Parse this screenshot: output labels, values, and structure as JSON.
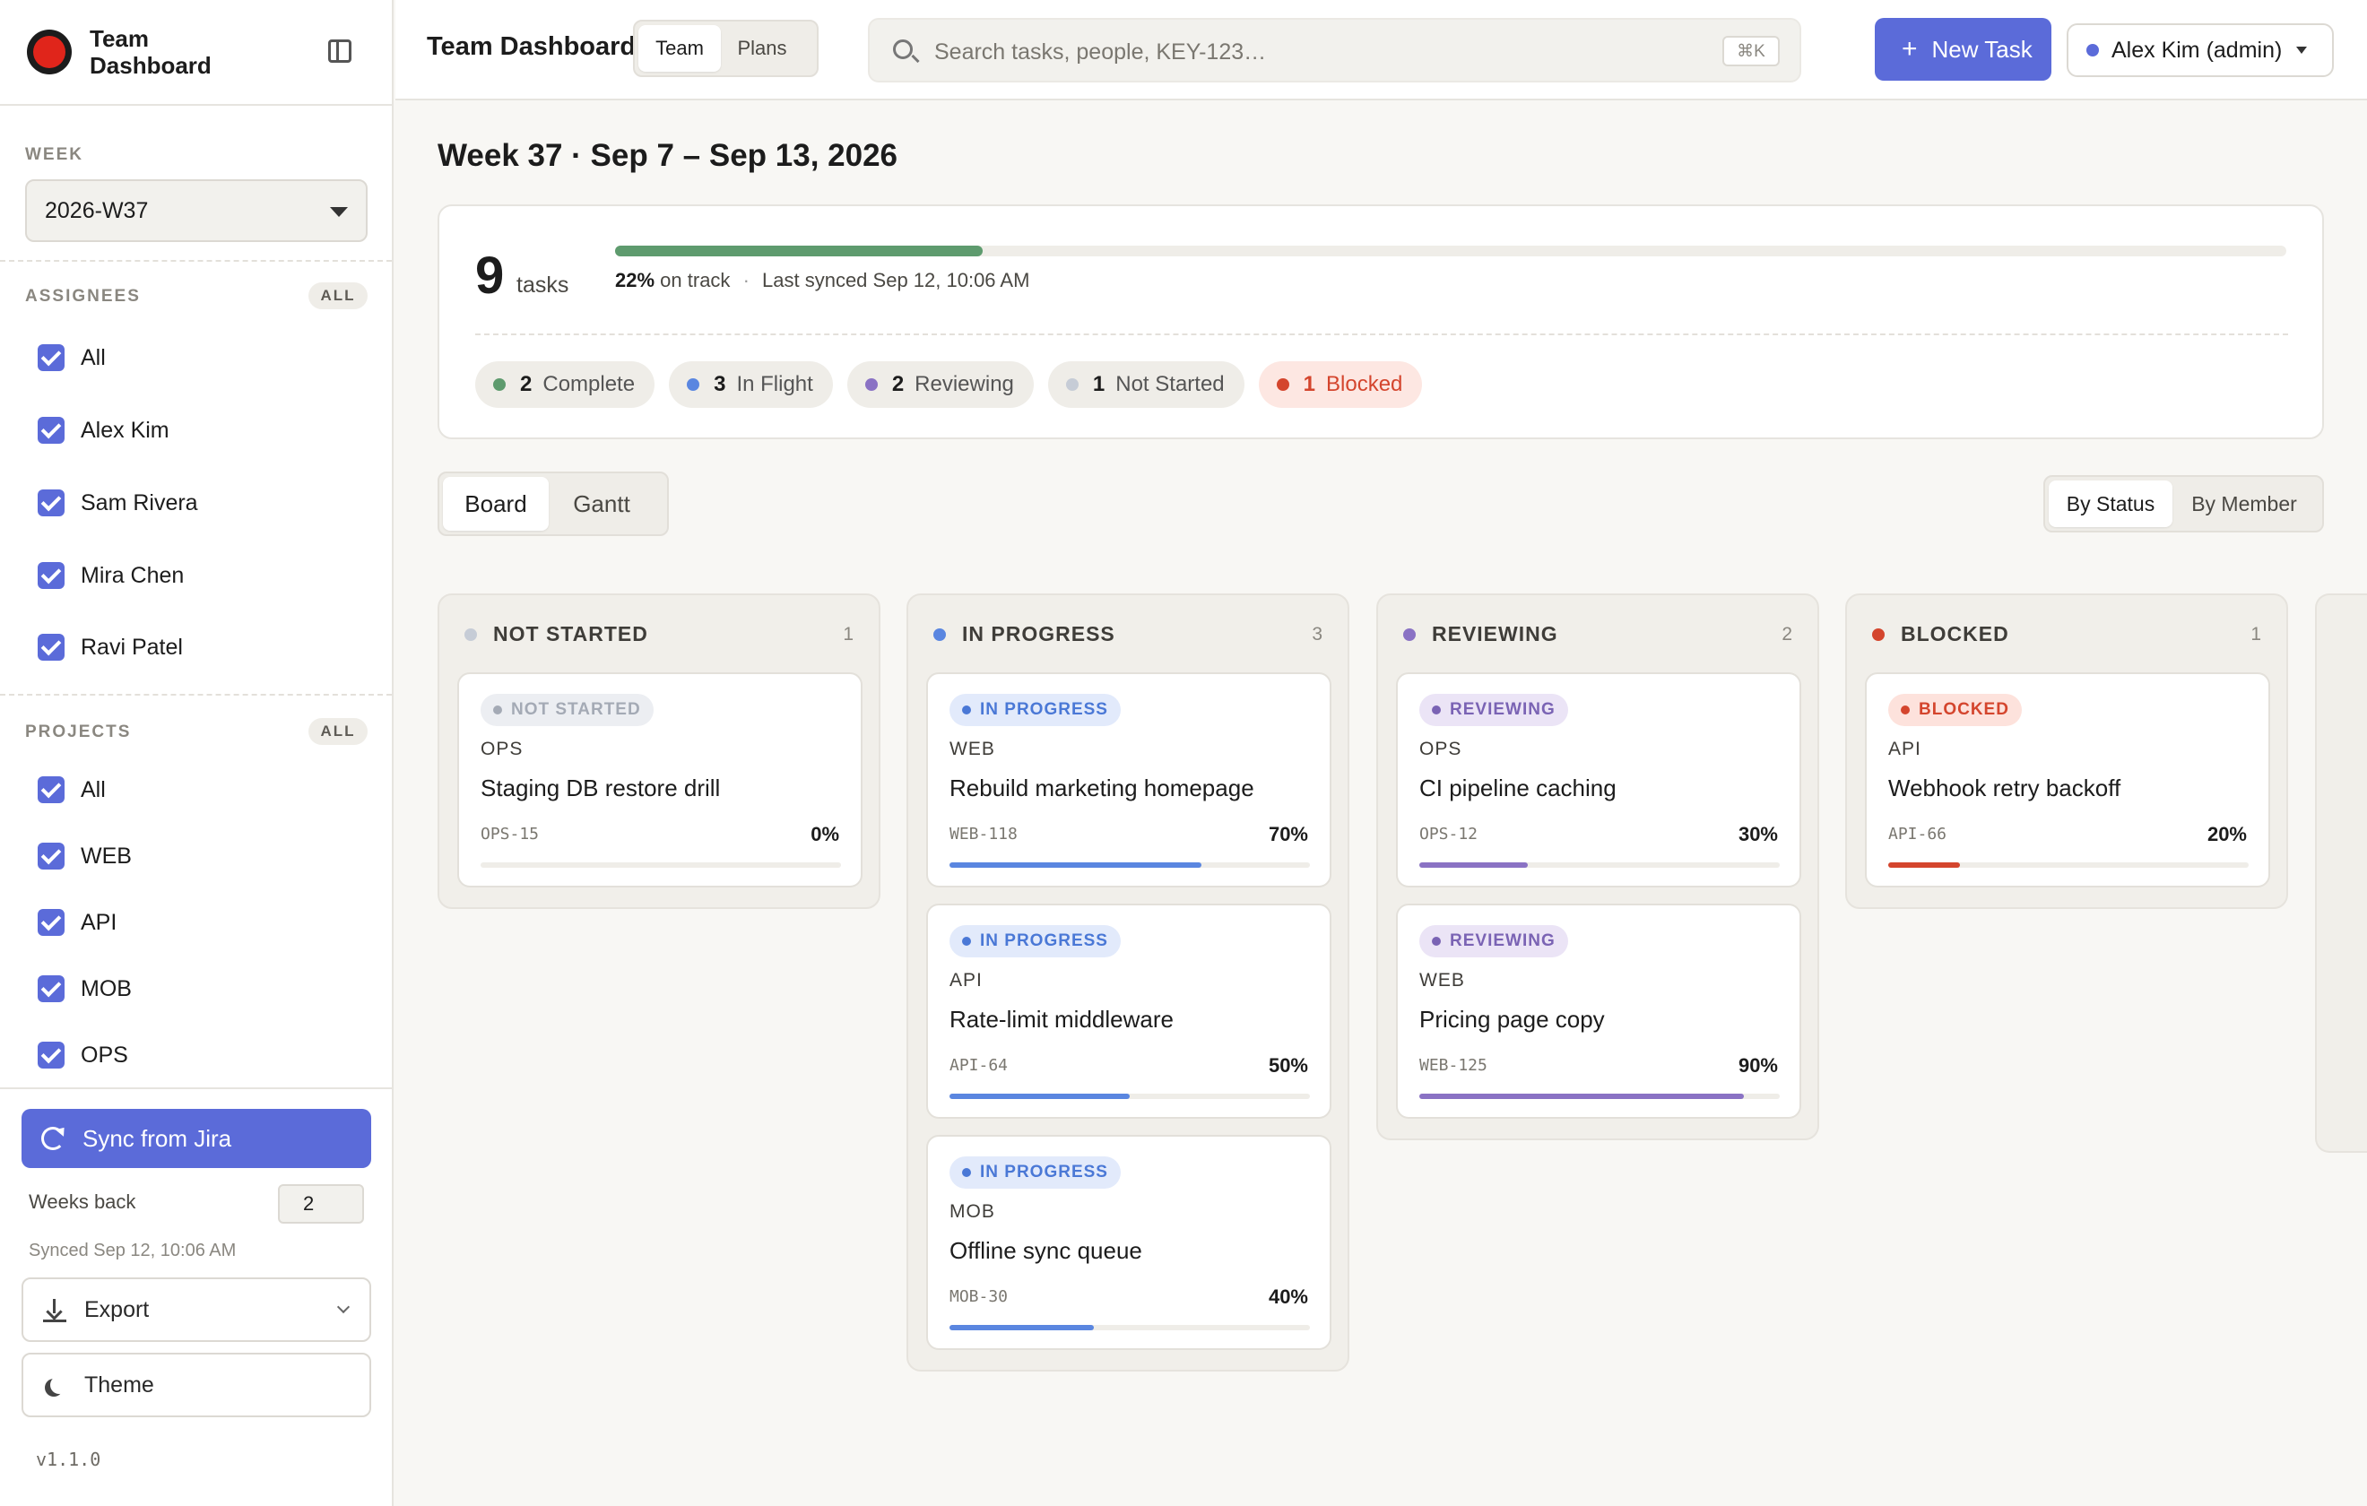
{
  "app": {
    "name": "Team Dashboard"
  },
  "sidebar": {
    "week_label": "WEEK",
    "week_value": "2026-W37",
    "assignees_label": "ASSIGNEES",
    "assignees_all_pill": "ALL",
    "assignees": [
      "All",
      "Alex Kim",
      "Sam Rivera",
      "Mira Chen",
      "Ravi Patel"
    ],
    "projects_label": "PROJECTS",
    "projects_all_pill": "ALL",
    "projects": [
      "All",
      "WEB",
      "API",
      "MOB",
      "OPS"
    ],
    "sync_label": "Sync from Jira",
    "weeks_back_label": "Weeks back",
    "weeks_back_value": "2",
    "synced_note": "Synced Sep 12, 10:06 AM",
    "export_label": "Export",
    "theme_label": "Theme",
    "version": "v1.1.0"
  },
  "header": {
    "title": "Team Dashboard",
    "tabs": [
      "Team",
      "Plans"
    ],
    "active_tab": "Team",
    "search_placeholder": "Search tasks, people, KEY-123…",
    "search_shortcut": "⌘K",
    "new_task_label": "New Task",
    "user_label": "Alex Kim (admin)"
  },
  "main": {
    "week_title": "Week 37 · Sep 7 – Sep 13, 2026",
    "summary": {
      "task_count": "9",
      "tasks_word": "tasks",
      "on_track_pct": "22%",
      "on_track_fraction": 0.22,
      "on_track_text": "on track",
      "separator": "·",
      "last_synced": "Last synced Sep 12, 10:06 AM",
      "chips": [
        {
          "count": "2",
          "label": "Complete",
          "color": "#5e9b6e"
        },
        {
          "count": "3",
          "label": "In Flight",
          "color": "#5a86e0"
        },
        {
          "count": "2",
          "label": "Reviewing",
          "color": "#8a72c4"
        },
        {
          "count": "1",
          "label": "Not Started",
          "color": "#c6ccd6"
        },
        {
          "count": "1",
          "label": "Blocked",
          "color": "#d4452d"
        }
      ]
    },
    "view_tabs": [
      "Board",
      "Gantt"
    ],
    "group_tabs": [
      "By Status",
      "By Member"
    ]
  },
  "board": {
    "columns": [
      {
        "title": "NOT STARTED",
        "count": "1",
        "color": "#c6ccd6",
        "cards": [
          {
            "badge": "NOT STARTED",
            "project": "OPS",
            "title": "Staging DB restore drill",
            "key": "OPS-15",
            "pct": "0%",
            "progress": 0
          }
        ]
      },
      {
        "title": "IN PROGRESS",
        "count": "3",
        "color": "#5a86e0",
        "cards": [
          {
            "badge": "IN PROGRESS",
            "project": "WEB",
            "title": "Rebuild marketing homepage",
            "key": "WEB-118",
            "pct": "70%",
            "progress": 0.7
          },
          {
            "badge": "IN PROGRESS",
            "project": "API",
            "title": "Rate-limit middleware",
            "key": "API-64",
            "pct": "50%",
            "progress": 0.5
          },
          {
            "badge": "IN PROGRESS",
            "project": "MOB",
            "title": "Offline sync queue",
            "key": "MOB-30",
            "pct": "40%",
            "progress": 0.4
          }
        ]
      },
      {
        "title": "REVIEWING",
        "count": "2",
        "color": "#8a72c4",
        "cards": [
          {
            "badge": "REVIEWING",
            "project": "OPS",
            "title": "CI pipeline caching",
            "key": "OPS-12",
            "pct": "30%",
            "progress": 0.3
          },
          {
            "badge": "REVIEWING",
            "project": "WEB",
            "title": "Pricing page copy",
            "key": "WEB-125",
            "pct": "90%",
            "progress": 0.9
          }
        ]
      },
      {
        "title": "BLOCKED",
        "count": "1",
        "color": "#d4452d",
        "cards": [
          {
            "badge": "BLOCKED",
            "project": "API",
            "title": "Webhook retry backoff",
            "key": "API-66",
            "pct": "20%",
            "progress": 0.2
          }
        ]
      }
    ]
  }
}
